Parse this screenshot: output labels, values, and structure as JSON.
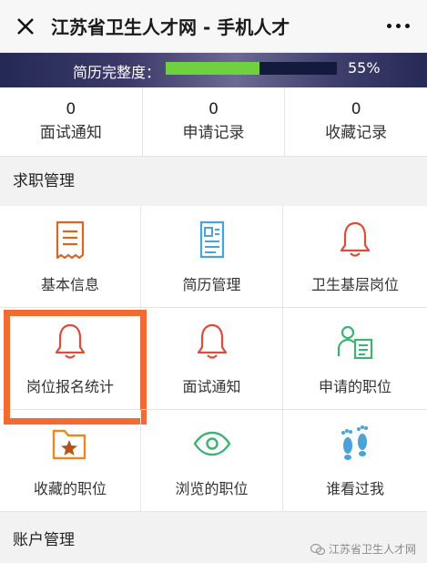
{
  "header": {
    "title": "江苏省卫生人才网 - 手机人才",
    "close_icon": "close-icon",
    "more_icon": "more-icon"
  },
  "banner": {
    "label": "简历完整度：",
    "progress": 0.55,
    "progress_text": "55%",
    "fill_color": "#6fd13d"
  },
  "counts": [
    {
      "value": "0",
      "label": "面试通知"
    },
    {
      "value": "0",
      "label": "申请记录"
    },
    {
      "value": "0",
      "label": "收藏记录"
    }
  ],
  "sections": {
    "job_title": "求职管理",
    "account_title": "账户管理"
  },
  "grid": [
    {
      "label": "基本信息",
      "icon": "document-icon",
      "color": "#d9661f"
    },
    {
      "label": "简历管理",
      "icon": "resume-icon",
      "color": "#4aa3d8"
    },
    {
      "label": "卫生基层岗位",
      "icon": "bell-icon",
      "color": "#d94d3a"
    },
    {
      "label": "岗位报名统计",
      "icon": "bell-icon",
      "color": "#d94d3a"
    },
    {
      "label": "面试通知",
      "icon": "bell-icon",
      "color": "#d94d3a"
    },
    {
      "label": "申请的职位",
      "icon": "user-card-icon",
      "color": "#3cb371"
    },
    {
      "label": "收藏的职位",
      "icon": "folder-star-icon",
      "color": "#e38a2a"
    },
    {
      "label": "浏览的职位",
      "icon": "eye-icon",
      "color": "#3cb371"
    },
    {
      "label": "谁看过我",
      "icon": "footprints-icon",
      "color": "#4aa3d8"
    }
  ],
  "highlight_color": "#f36b32",
  "watermark": "江苏省卫生人才网"
}
